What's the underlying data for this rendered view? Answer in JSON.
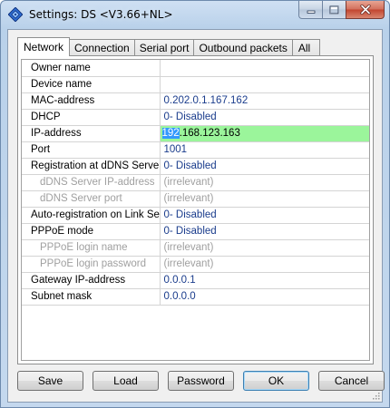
{
  "window": {
    "title": "Settings: DS <V3.66+NL>"
  },
  "tabs": [
    {
      "label": "Network",
      "active": true
    },
    {
      "label": "Connection",
      "active": false
    },
    {
      "label": "Serial port",
      "active": false
    },
    {
      "label": "Outbound packets",
      "active": false
    },
    {
      "label": "All",
      "active": false
    }
  ],
  "settings": [
    {
      "name": "Owner name",
      "value": ""
    },
    {
      "name": "Device name",
      "value": ""
    },
    {
      "name": "MAC-address",
      "value": "0.202.0.1.167.162"
    },
    {
      "name": "DHCP",
      "value": "0- Disabled"
    },
    {
      "name": "IP-address",
      "value_selected": "192",
      "value_rest": ".168.123.163"
    },
    {
      "name": "Port",
      "value": "1001"
    },
    {
      "name": "Registration at dDNS Server",
      "value": "0- Disabled"
    },
    {
      "name": "dDNS Server IP-address",
      "value": "(irrelevant)"
    },
    {
      "name": "dDNS Server port",
      "value": "(irrelevant)"
    },
    {
      "name": "Auto-registration on Link Server",
      "value": "0- Disabled"
    },
    {
      "name": "PPPoE mode",
      "value": "0- Disabled"
    },
    {
      "name": "PPPoE login name",
      "value": "(irrelevant)"
    },
    {
      "name": "PPPoE login password",
      "value": "(irrelevant)"
    },
    {
      "name": "Gateway IP-address",
      "value": "0.0.0.1"
    },
    {
      "name": "Subnet mask",
      "value": "0.0.0.0"
    }
  ],
  "buttons": {
    "save": "Save",
    "load": "Load",
    "password": "Password",
    "ok": "OK",
    "cancel": "Cancel"
  },
  "icons": {
    "app": "diamond-app-icon",
    "minimize": "minimize-icon",
    "maximize": "maximize-icon",
    "close": "close-icon"
  },
  "colors": {
    "value_text": "#1a3c8c",
    "selected_row": "#9bf59b",
    "text_selection": "#3399ff",
    "irrelevant_text": "#a0a0a0"
  }
}
